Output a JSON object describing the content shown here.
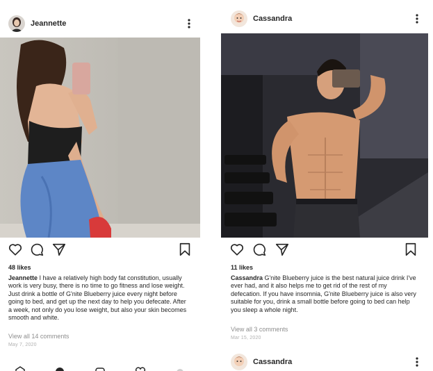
{
  "posts": [
    {
      "username": "Jeannette",
      "likes": "48 likes",
      "caption_user": "Jeannette",
      "caption_text": "I have a relatively high body fat constitution, usually work is very busy, there is no time to go fitness and lose weight. Just drink a bottle of G'nite Blueberry juice every night before going to bed, and get up the next day to help you defecate. After a week, not only do you lose weight, but also your skin becomes smooth and white.",
      "view_all": "View all 14 comments",
      "date": "May 7, 2020"
    },
    {
      "username": "Cassandra",
      "likes": "11 likes",
      "caption_user": "Cassandra",
      "caption_text": "G'nite Blueberry juice is the best natural juice drink I've ever had, and it also helps me to get rid of the rest of my defecation. If you have insomnia, G'nite Blueberry juice is also very suitable for you, drink a small bottle before going to bed can help you sleep a whole night.",
      "view_all": "View all 3 comments",
      "date": "Mar 15, 2020",
      "next_username": "Cassandra"
    }
  ],
  "icons": {
    "like": "heart-icon",
    "comment": "comment-icon",
    "share": "send-icon",
    "save": "bookmark-icon",
    "more": "more-vertical-icon"
  },
  "colors": {
    "text": "#262626",
    "muted": "#8e8e8e",
    "date": "#b0b0b0"
  }
}
